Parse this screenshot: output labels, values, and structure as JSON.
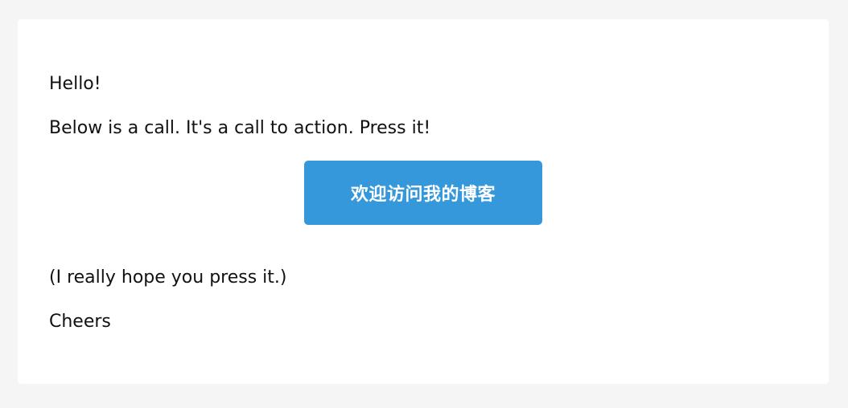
{
  "email": {
    "greeting": "Hello!",
    "intro": "Below is a call. It's a call to action. Press it!",
    "cta_label": "欢迎访问我的博客",
    "hope": "(I really hope you press it.)",
    "signoff": "Cheers"
  },
  "colors": {
    "page_background": "#f5f5f5",
    "card_background": "#ffffff",
    "button": "#3498db",
    "button_text": "#ffffff",
    "text": "#111111"
  }
}
